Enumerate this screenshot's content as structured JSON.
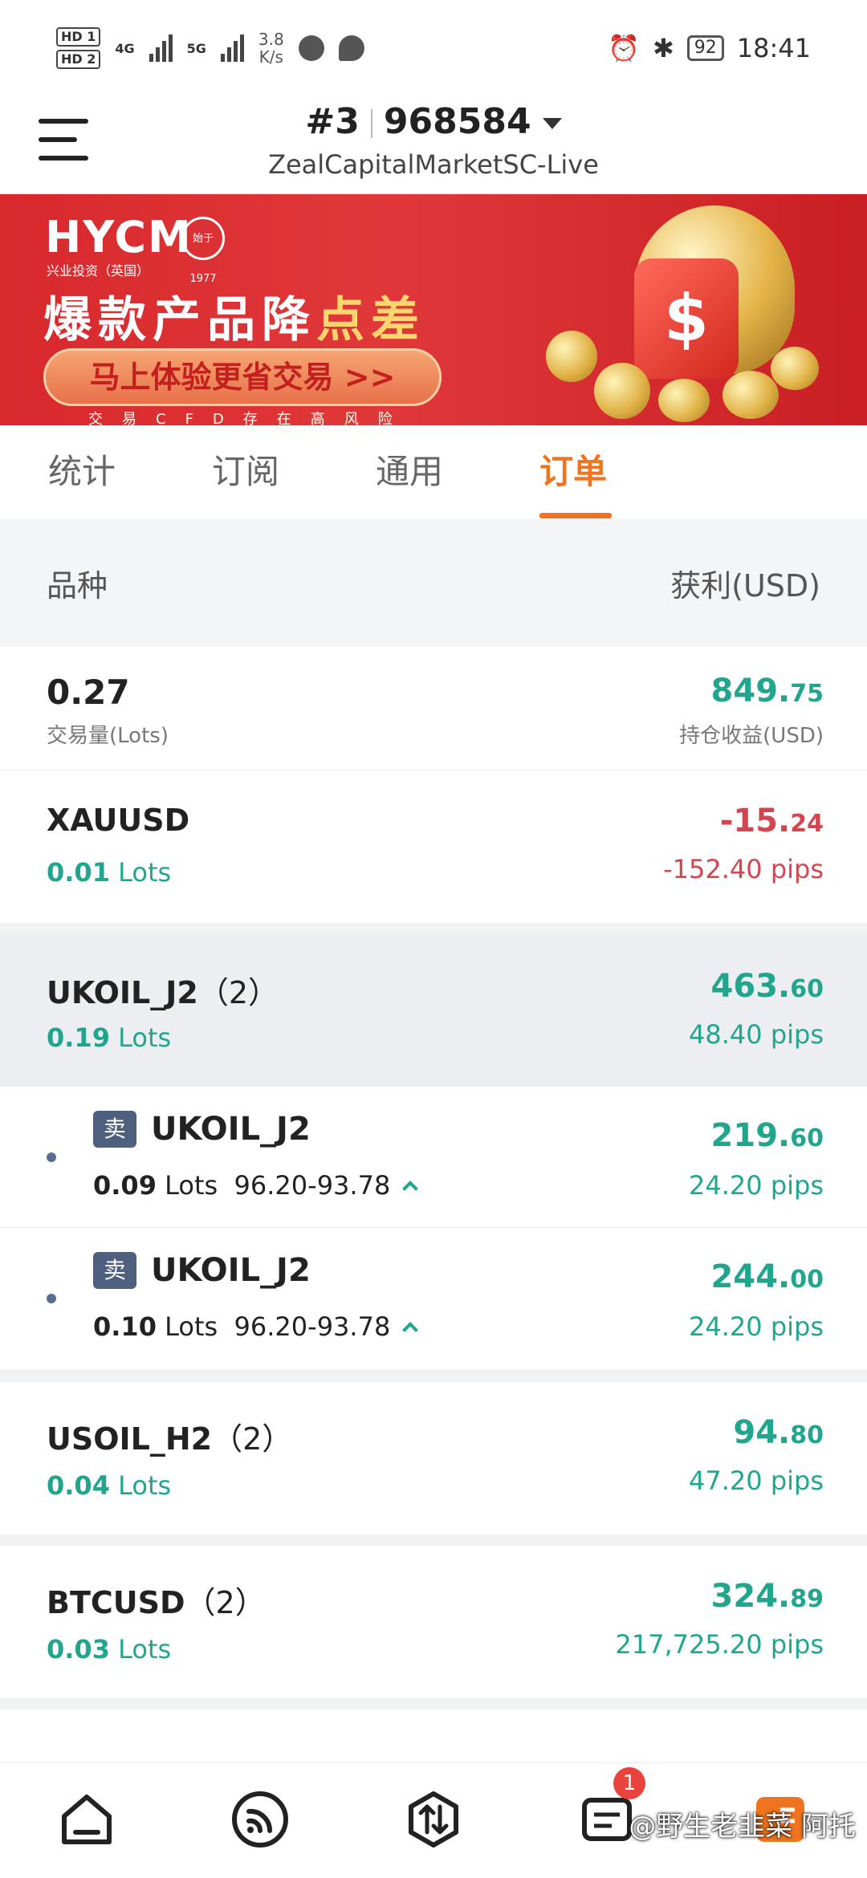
{
  "status_bar": {
    "hd1": "HD 1",
    "hd2": "HD 2",
    "net1": "4G",
    "net2": "5G",
    "speed_value": "3.8",
    "speed_unit": "K/s",
    "battery": "92",
    "time": "18:41"
  },
  "header": {
    "account_prefix": "#3",
    "account_number": "968584",
    "server": "ZealCapitalMarketSC-Live"
  },
  "banner": {
    "logo": "HYCM",
    "logo_sub": "兴业投资（英国）",
    "seal": "始于1977",
    "headline_main": "爆款产品降",
    "headline_highlight": "点差",
    "cta": "马上体验更省交易 >>",
    "risk": "交易CFD存在高风险"
  },
  "tabs": [
    {
      "label": "统计"
    },
    {
      "label": "订阅"
    },
    {
      "label": "通用"
    },
    {
      "label": "订单"
    }
  ],
  "active_tab": "订单",
  "columns": {
    "left": "品种",
    "right": "获利(USD)"
  },
  "summary": {
    "volume": "0.27",
    "volume_label": "交易量(Lots)",
    "profit_int": "849.",
    "profit_dec": "75",
    "profit_label": "持仓收益(USD)"
  },
  "orders": [
    {
      "symbol": "XAUUSD",
      "count": "",
      "lots": "0.01",
      "lots_unit": "Lots",
      "profit_int": "-15.",
      "profit_dec": "24",
      "pips": "-152.40 pips",
      "color": "#d4464f"
    },
    {
      "symbol": "UKOIL_J2",
      "count": "（2）",
      "lots": "0.19",
      "lots_unit": "Lots",
      "profit_int": "463.",
      "profit_dec": "60",
      "pips": "48.40 pips",
      "color": "#21a68d"
    },
    {
      "symbol": "USOIL_H2",
      "count": "（2）",
      "lots": "0.04",
      "lots_unit": "Lots",
      "profit_int": "94.",
      "profit_dec": "80",
      "pips": "47.20 pips",
      "color": "#21a68d"
    },
    {
      "symbol": "BTCUSD",
      "count": "（2）",
      "lots": "0.03",
      "lots_unit": "Lots",
      "profit_int": "324.",
      "profit_dec": "89",
      "pips": "217,725.20 pips",
      "color": "#21a68d"
    }
  ],
  "sub_orders": [
    {
      "side": "卖",
      "symbol": "UKOIL_J2",
      "lots": "0.09",
      "lots_unit": "Lots",
      "range": "96.20-93.78",
      "profit_int": "219.",
      "profit_dec": "60",
      "pips": "24.20 pips"
    },
    {
      "side": "卖",
      "symbol": "UKOIL_J2",
      "lots": "0.10",
      "lots_unit": "Lots",
      "range": "96.20-93.78",
      "profit_int": "244.",
      "profit_dec": "00",
      "pips": "24.20 pips"
    }
  ],
  "bottom_nav": {
    "badge": "1",
    "icons": [
      "home-icon",
      "signal-icon",
      "trade-icon",
      "orders-icon",
      "profile-icon"
    ]
  },
  "watermark": "@野生老韭菜 阿托",
  "colors": {
    "accent": "#f0741f",
    "profit": "#21a68d",
    "loss": "#d4464f",
    "banner": "#d8292d"
  }
}
